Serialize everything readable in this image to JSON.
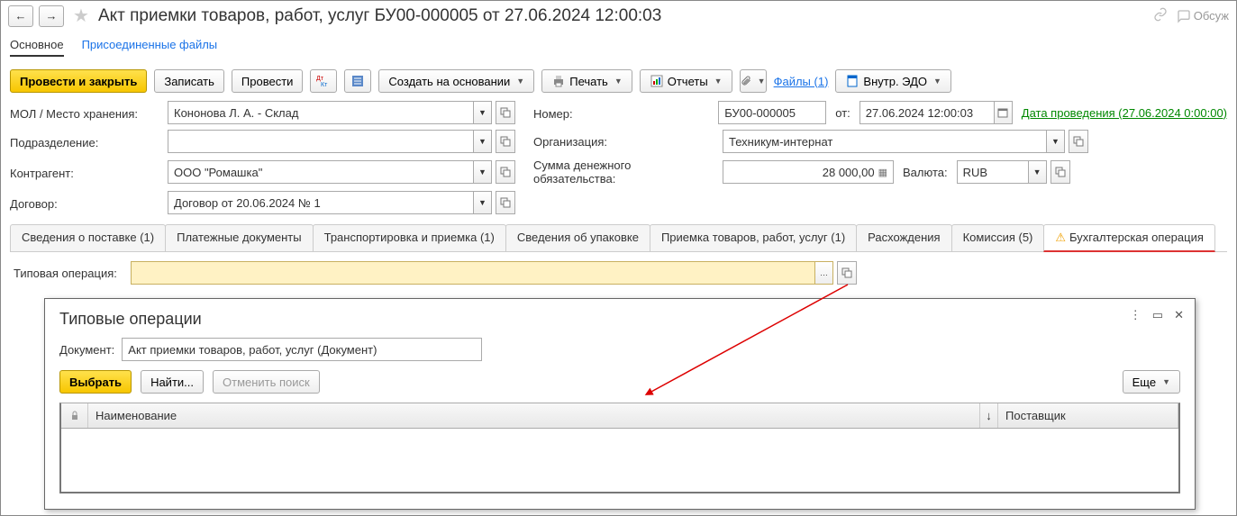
{
  "header": {
    "title": "Акт приемки товаров, работ, услуг БУ00-000005 от 27.06.2024 12:00:03",
    "discuss": "Обсуж"
  },
  "sections": {
    "main": "Основное",
    "files": "Присоединенные файлы"
  },
  "toolbar": {
    "post_close": "Провести и закрыть",
    "save": "Записать",
    "post": "Провести",
    "create_based": "Создать на основании",
    "print": "Печать",
    "reports": "Отчеты",
    "files_link": "Файлы (1)",
    "internal_edo": "Внутр. ЭДО"
  },
  "form": {
    "mol_label": "МОЛ / Место хранения:",
    "mol_value": "Кононова Л. А. - Склад",
    "number_label": "Номер:",
    "number_value": "БУ00-000005",
    "from_label": "от:",
    "date_value": "27.06.2024 12:00:03",
    "posting_link": "Дата проведения (27.06.2024 0:00:00)",
    "division_label": "Подразделение:",
    "division_value": "",
    "org_label": "Организация:",
    "org_value": "Техникум-интернат",
    "counterparty_label": "Контрагент:",
    "counterparty_value": "ООО \"Ромашка\"",
    "sum_label": "Сумма денежного обязательства:",
    "sum_value": "28 000,00",
    "currency_label": "Валюта:",
    "currency_value": "RUB",
    "contract_label": "Договор:",
    "contract_value": "Договор от 20.06.2024 № 1"
  },
  "tabs": {
    "supply": "Сведения о поставке (1)",
    "payments": "Платежные документы",
    "transport": "Транспортировка и приемка (1)",
    "packaging": "Сведения об упаковке",
    "acceptance": "Приемка товаров, работ, услуг (1)",
    "discrepancy": "Расхождения",
    "commission": "Комиссия (5)",
    "accounting": "Бухгалтерская операция"
  },
  "typop": {
    "label": "Типовая операция:"
  },
  "popup": {
    "title": "Типовые операции",
    "doc_label": "Документ:",
    "doc_value": "Акт приемки товаров, работ, услуг (Документ)",
    "select": "Выбрать",
    "find": "Найти...",
    "cancel_search": "Отменить поиск",
    "more": "Еще",
    "col_name": "Наименование",
    "col_supplier": "Поставщик"
  }
}
